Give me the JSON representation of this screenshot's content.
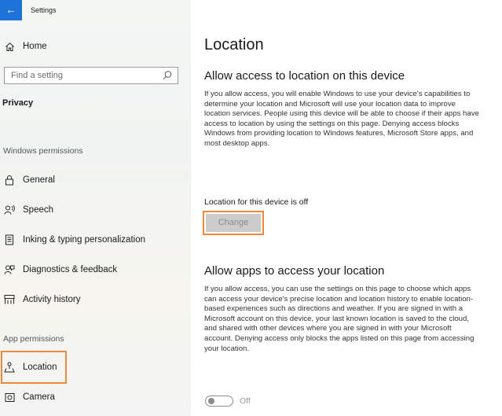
{
  "window": {
    "title": "Settings",
    "back_glyph": "←"
  },
  "sidebar": {
    "home_label": "Home",
    "search": {
      "placeholder": "Find a setting"
    },
    "section_heading": "Privacy",
    "windows_permissions_heading": "Windows permissions",
    "windows_permissions_items": [
      {
        "label": "General",
        "icon": "lock-icon"
      },
      {
        "label": "Speech",
        "icon": "speech-icon"
      },
      {
        "label": "Inking & typing personalization",
        "icon": "inking-icon"
      },
      {
        "label": "Diagnostics & feedback",
        "icon": "diagnostics-icon"
      },
      {
        "label": "Activity history",
        "icon": "activity-history-icon"
      }
    ],
    "app_permissions_heading": "App permissions",
    "app_permissions_items": [
      {
        "label": "Location",
        "icon": "location-icon",
        "selected": true
      },
      {
        "label": "Camera",
        "icon": "camera-icon"
      }
    ]
  },
  "main": {
    "page_title": "Location",
    "device_section": {
      "title": "Allow access to location on this device",
      "description": "If you allow access, you will enable Windows to use your device's capabilities to determine your location and Microsoft will use your location data to improve location services. People using this device will be able to choose if their apps have access to location by using the settings on this page. Denying access blocks Windows from providing location to Windows features, Microsoft Store apps, and most desktop apps.",
      "status": "Location for this device is off",
      "change_button": "Change"
    },
    "apps_section": {
      "title": "Allow apps to access your location",
      "description": "If you allow access, you can use the settings on this page to choose which apps can access your device's precise location and location history to enable location-based experiences such as directions and weather. If you are signed in with a Microsoft account on this device, your last known location is saved to the cloud, and shared with other devices where you are signed in with your Microsoft account. Denying access only blocks the apps listed on this page from accessing your location.",
      "toggle_state": "Off"
    }
  },
  "colors": {
    "accent": "#1e73d8",
    "highlight": "#f0883a",
    "disabled_button": "#cccccc"
  }
}
